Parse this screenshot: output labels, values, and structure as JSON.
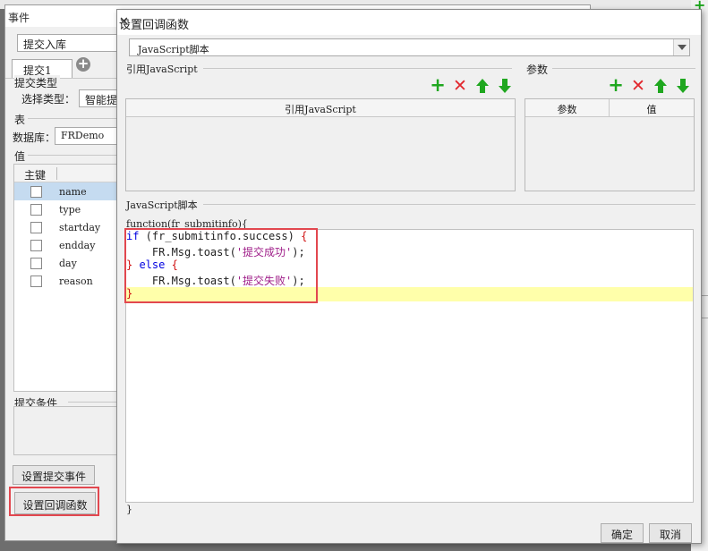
{
  "event_dialog": {
    "title": "事件",
    "event_name": "提交入库",
    "tab_label": "提交1",
    "submit_type_group": "提交类型",
    "select_type_label": "选择类型：",
    "select_type_value": "智能提",
    "table_group": "表",
    "database_label": "数据库：",
    "database_value": "FRDemo",
    "values_group": "值",
    "primary_key_header": "主键",
    "fields": [
      "name",
      "type",
      "startday",
      "endday",
      "day",
      "reason"
    ],
    "condition_group": "提交条件",
    "set_submit_event_button": "设置提交事件",
    "set_callback_button": "设置回调函数"
  },
  "callback_dialog": {
    "title": "设置回调函数",
    "type_value": "JavaScript脚本",
    "ref_group": "引用JavaScript",
    "ref_header": "引用JavaScript",
    "param_group": "参数",
    "param_header": "参数",
    "value_header": "值",
    "script_group": "JavaScript脚本",
    "code_head": "function(fr_submitinfo){",
    "code_tail": "}",
    "code": {
      "l1_kw": "if",
      "l1_text": " (fr_submitinfo.success) ",
      "l1_brace": "{",
      "l2_text": "    FR.Msg.toast(",
      "l2_str": "'提交成功'",
      "l2_end": ");",
      "l3_brace1": "}",
      "l3_kw": " else ",
      "l3_brace2": "{",
      "l4_text": "    FR.Msg.toast(",
      "l4_str": "'提交失败'",
      "l4_end": ");",
      "l5_brace": "}"
    },
    "ok_button": "确定",
    "cancel_button": "取消",
    "icons": {
      "add": "plus-icon",
      "delete": "delete-icon",
      "move_up": "arrow-up-icon",
      "move_down": "arrow-down-icon"
    }
  },
  "colors": {
    "add_icon": "#1fa71f",
    "delete_icon": "#e2272d",
    "highlight_box": "#e2474f",
    "current_line": "#ffffaa",
    "keyword": "#0000e0",
    "string": "#a0208a"
  }
}
